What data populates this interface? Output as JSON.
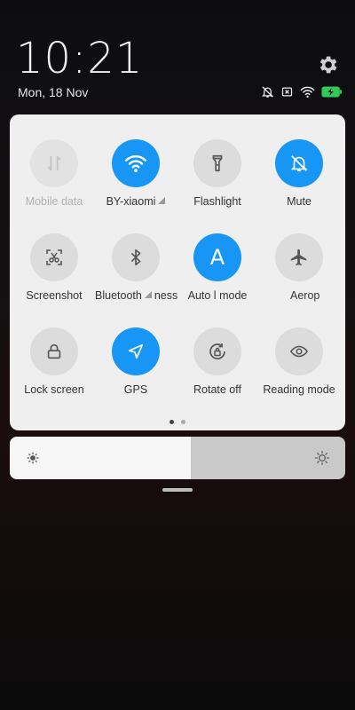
{
  "clock": {
    "time": "10:21",
    "date": "Mon, 18 Nov"
  },
  "settings": {
    "icon": "gear-icon"
  },
  "status_bar": {
    "icons": [
      "silent-icon",
      "sim-off-icon",
      "wifi-icon",
      "battery-charging-icon"
    ],
    "battery_color": "#34c759"
  },
  "accent_color": "#1796f5",
  "toggles": [
    {
      "label": "Mobile data",
      "icon": "mobile-data-icon",
      "state": "disabled"
    },
    {
      "label": "BY-xiaomi",
      "icon": "wifi-icon",
      "state": "on"
    },
    {
      "label": "Flashlight",
      "icon": "flashlight-icon",
      "state": "off"
    },
    {
      "label": "Mute",
      "icon": "bell-off-icon",
      "state": "on"
    },
    {
      "label": "Screenshot",
      "icon": "screenshot-icon",
      "state": "off"
    },
    {
      "label": "Bluetooth",
      "icon": "bluetooth-icon",
      "state": "off"
    },
    {
      "label": "Auto brightness",
      "label_visible": "ness",
      "icon": "auto-brightness-icon",
      "state": "on"
    },
    {
      "label": "Auto mode",
      "label_visible": "Auto l",
      "label_visible2": "mode",
      "icon": "auto-mode-icon",
      "state": "off"
    },
    {
      "label": "Aeroplane mode",
      "label_visible": "Aerop",
      "icon": "airplane-icon",
      "state": "off"
    },
    {
      "label": "Lock screen",
      "icon": "lock-icon",
      "state": "off"
    },
    {
      "label": "GPS",
      "icon": "location-arrow-icon",
      "state": "on"
    },
    {
      "label": "Rotate off",
      "icon": "rotate-lock-icon",
      "state": "off"
    },
    {
      "label": "Reading mode",
      "icon": "eye-icon",
      "state": "off"
    }
  ],
  "page_indicator": {
    "pages": 2,
    "current": 1
  },
  "brightness": {
    "level": 0.54
  }
}
